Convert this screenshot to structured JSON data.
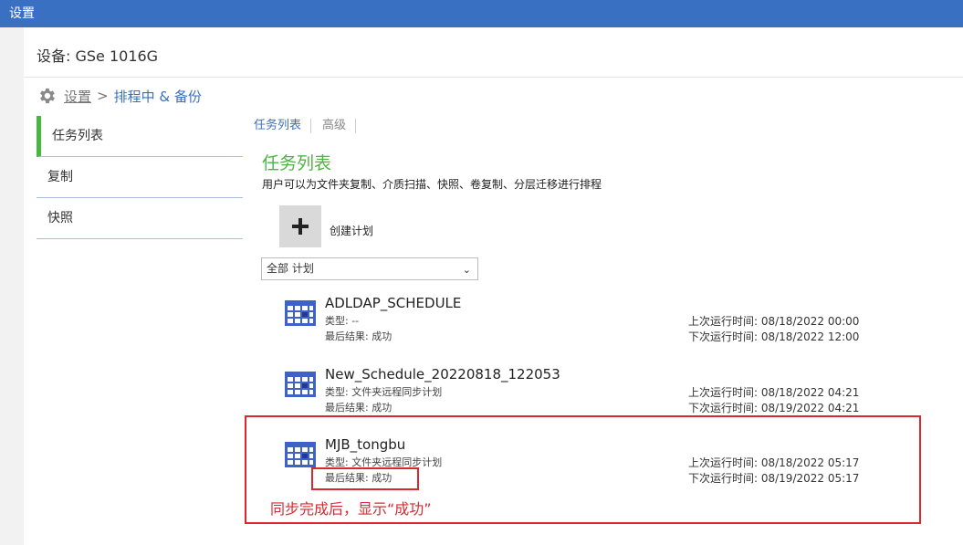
{
  "window": {
    "title": "设置"
  },
  "device": {
    "title": "设备: GSe 1016G"
  },
  "breadcrumb": {
    "root": "设置",
    "separator": ">",
    "current": "排程中 & 备份"
  },
  "sidebar": {
    "items": [
      {
        "label": "任务列表",
        "active": true
      },
      {
        "label": "复制",
        "active": false
      },
      {
        "label": "快照",
        "active": false
      }
    ]
  },
  "tabs": [
    {
      "label": "任务列表",
      "active": true
    },
    {
      "label": "高级",
      "active": false
    }
  ],
  "section": {
    "title": "任务列表",
    "description": "用户可以为文件夹复制、介质扫描、快照、卷复制、分层迁移进行排程"
  },
  "create": {
    "label": "创建计划",
    "icon": "plus-icon"
  },
  "filter": {
    "selected": "全部 计划"
  },
  "schedules": [
    {
      "name": "ADLDAP_SCHEDULE",
      "type": "类型: --",
      "result": "最后结果: 成功",
      "last_run": "上次运行时间: 08/18/2022 00:00",
      "next_run": "下次运行时间: 08/18/2022 12:00"
    },
    {
      "name": "New_Schedule_20220818_122053",
      "type": "类型: 文件夹远程同步计划",
      "result": "最后结果: 成功",
      "last_run": "上次运行时间: 08/18/2022 04:21",
      "next_run": "下次运行时间: 08/19/2022 04:21"
    },
    {
      "name": "MJB_tongbu",
      "type": "类型: 文件夹远程同步计划",
      "result": "最后结果: 成功",
      "last_run": "上次运行时间: 08/18/2022 05:17",
      "next_run": "下次运行时间: 08/19/2022 05:17"
    }
  ],
  "annotation": {
    "text": "同步完成后，显示“成功”",
    "color": "#d9292f"
  },
  "colors": {
    "titlebar": "#3a70c2",
    "accent_green": "#4bb543",
    "link_blue": "#3a70c2",
    "calendar_blue": "#3f62c8"
  }
}
